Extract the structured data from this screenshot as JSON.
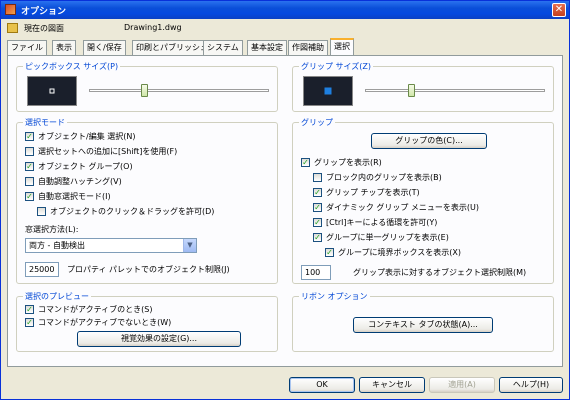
{
  "window": {
    "title": "オプション",
    "close": "✕"
  },
  "current_drawing": {
    "label": "現在の図面",
    "value": "Drawing1.dwg"
  },
  "tabs": [
    "ファイル",
    "表示",
    "開く/保存",
    "印刷とパブリッシュ",
    "システム",
    "基本設定",
    "作図補助",
    "選択"
  ],
  "pickbox": {
    "title": "ピックボックス サイズ(P)",
    "size_fraction": 0.3
  },
  "grip_size": {
    "title": "グリップ サイズ(Z)",
    "size_fraction": 0.25
  },
  "selection_mode": {
    "title": "選択モード",
    "items": [
      {
        "label": "オブジェクト/編集 選択(N)",
        "checked": true
      },
      {
        "label": "選択セットへの追加に[Shift]を使用(F)",
        "checked": false
      },
      {
        "label": "オブジェクト グループ(O)",
        "checked": true
      },
      {
        "label": "自動調整ハッチング(V)",
        "checked": false
      },
      {
        "label": "自動窓選択モード(I)",
        "checked": true
      },
      {
        "label": "オブジェクトのクリック＆ドラッグを許可(D)",
        "checked": false
      }
    ],
    "window_method_label": "窓選択方法(L):",
    "window_method_value": "両方 - 自動検出",
    "property_limit_value": "25000",
    "property_limit_label": "プロパティ パレットでのオブジェクト制限(J)"
  },
  "selection_preview": {
    "title": "選択のプレビュー",
    "items": [
      {
        "label": "コマンドがアクティブのとき(S)",
        "checked": true
      },
      {
        "label": "コマンドがアクティブでないとき(W)",
        "checked": true
      }
    ],
    "visual_effects_button": "視覚効果の設定(G)..."
  },
  "grips": {
    "title": "グリップ",
    "grip_colors_button": "グリップの色(C)...",
    "items": [
      {
        "label": "グリップを表示(R)",
        "checked": true
      },
      {
        "label": "ブロック内のグリップを表示(B)",
        "checked": false
      },
      {
        "label": "グリップ チップを表示(T)",
        "checked": true
      },
      {
        "label": "ダイナミック グリップ メニューを表示(U)",
        "checked": true
      },
      {
        "label": "[Ctrl]キーによる循環を許可(Y)",
        "checked": true
      },
      {
        "label": "グループに単一グリップを表示(E)",
        "checked": true
      },
      {
        "label": "グループに境界ボックスを表示(X)",
        "checked": true
      }
    ],
    "limit_value": "100",
    "limit_label": "グリップ表示に対するオブジェクト選択制限(M)"
  },
  "ribbon": {
    "title": "リボン オプション",
    "contextual_tab_button": "コンテキスト タブの状態(A)..."
  },
  "footer": {
    "ok": "OK",
    "cancel": "キャンセル",
    "apply": "適用(A)",
    "help": "ヘルプ(H)"
  },
  "colors": {
    "title_bar": "#0a4fd8",
    "group_title": "#0046d5",
    "grip_marker": "#1e7fe0",
    "check": "#21a121"
  }
}
